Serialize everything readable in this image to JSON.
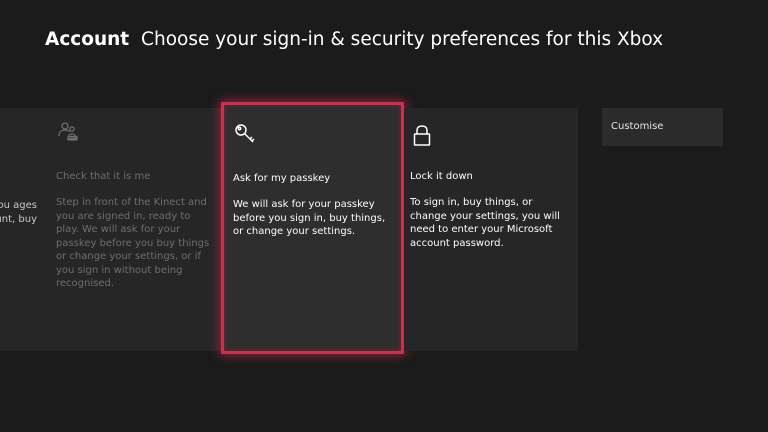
{
  "header": {
    "section": "Account",
    "subtitle": "Choose your sign-in & security preferences for this Xbox"
  },
  "options": {
    "partial": {
      "text": "sign you ages account, buy"
    },
    "kinect": {
      "icon": "kinect-user-icon",
      "title": "Check that it is me",
      "description": "Step in front of the Kinect and you are signed in, ready to play. We will ask for your passkey before you buy things or change your settings, or if you sign in without being recognised."
    },
    "passkey": {
      "icon": "key-icon",
      "title": "Ask for my passkey",
      "description": "We will ask for your passkey before you sign in, buy things, or change your settings."
    },
    "lock": {
      "icon": "lock-icon",
      "title": "Lock it down",
      "description": "To sign in, buy things, or change your settings, you will need to enter your Microsoft account password."
    },
    "customise": {
      "label": "Customise"
    }
  },
  "colors": {
    "background": "#1b1b1b",
    "card": "#262626",
    "focus_border": "#c8324e"
  }
}
